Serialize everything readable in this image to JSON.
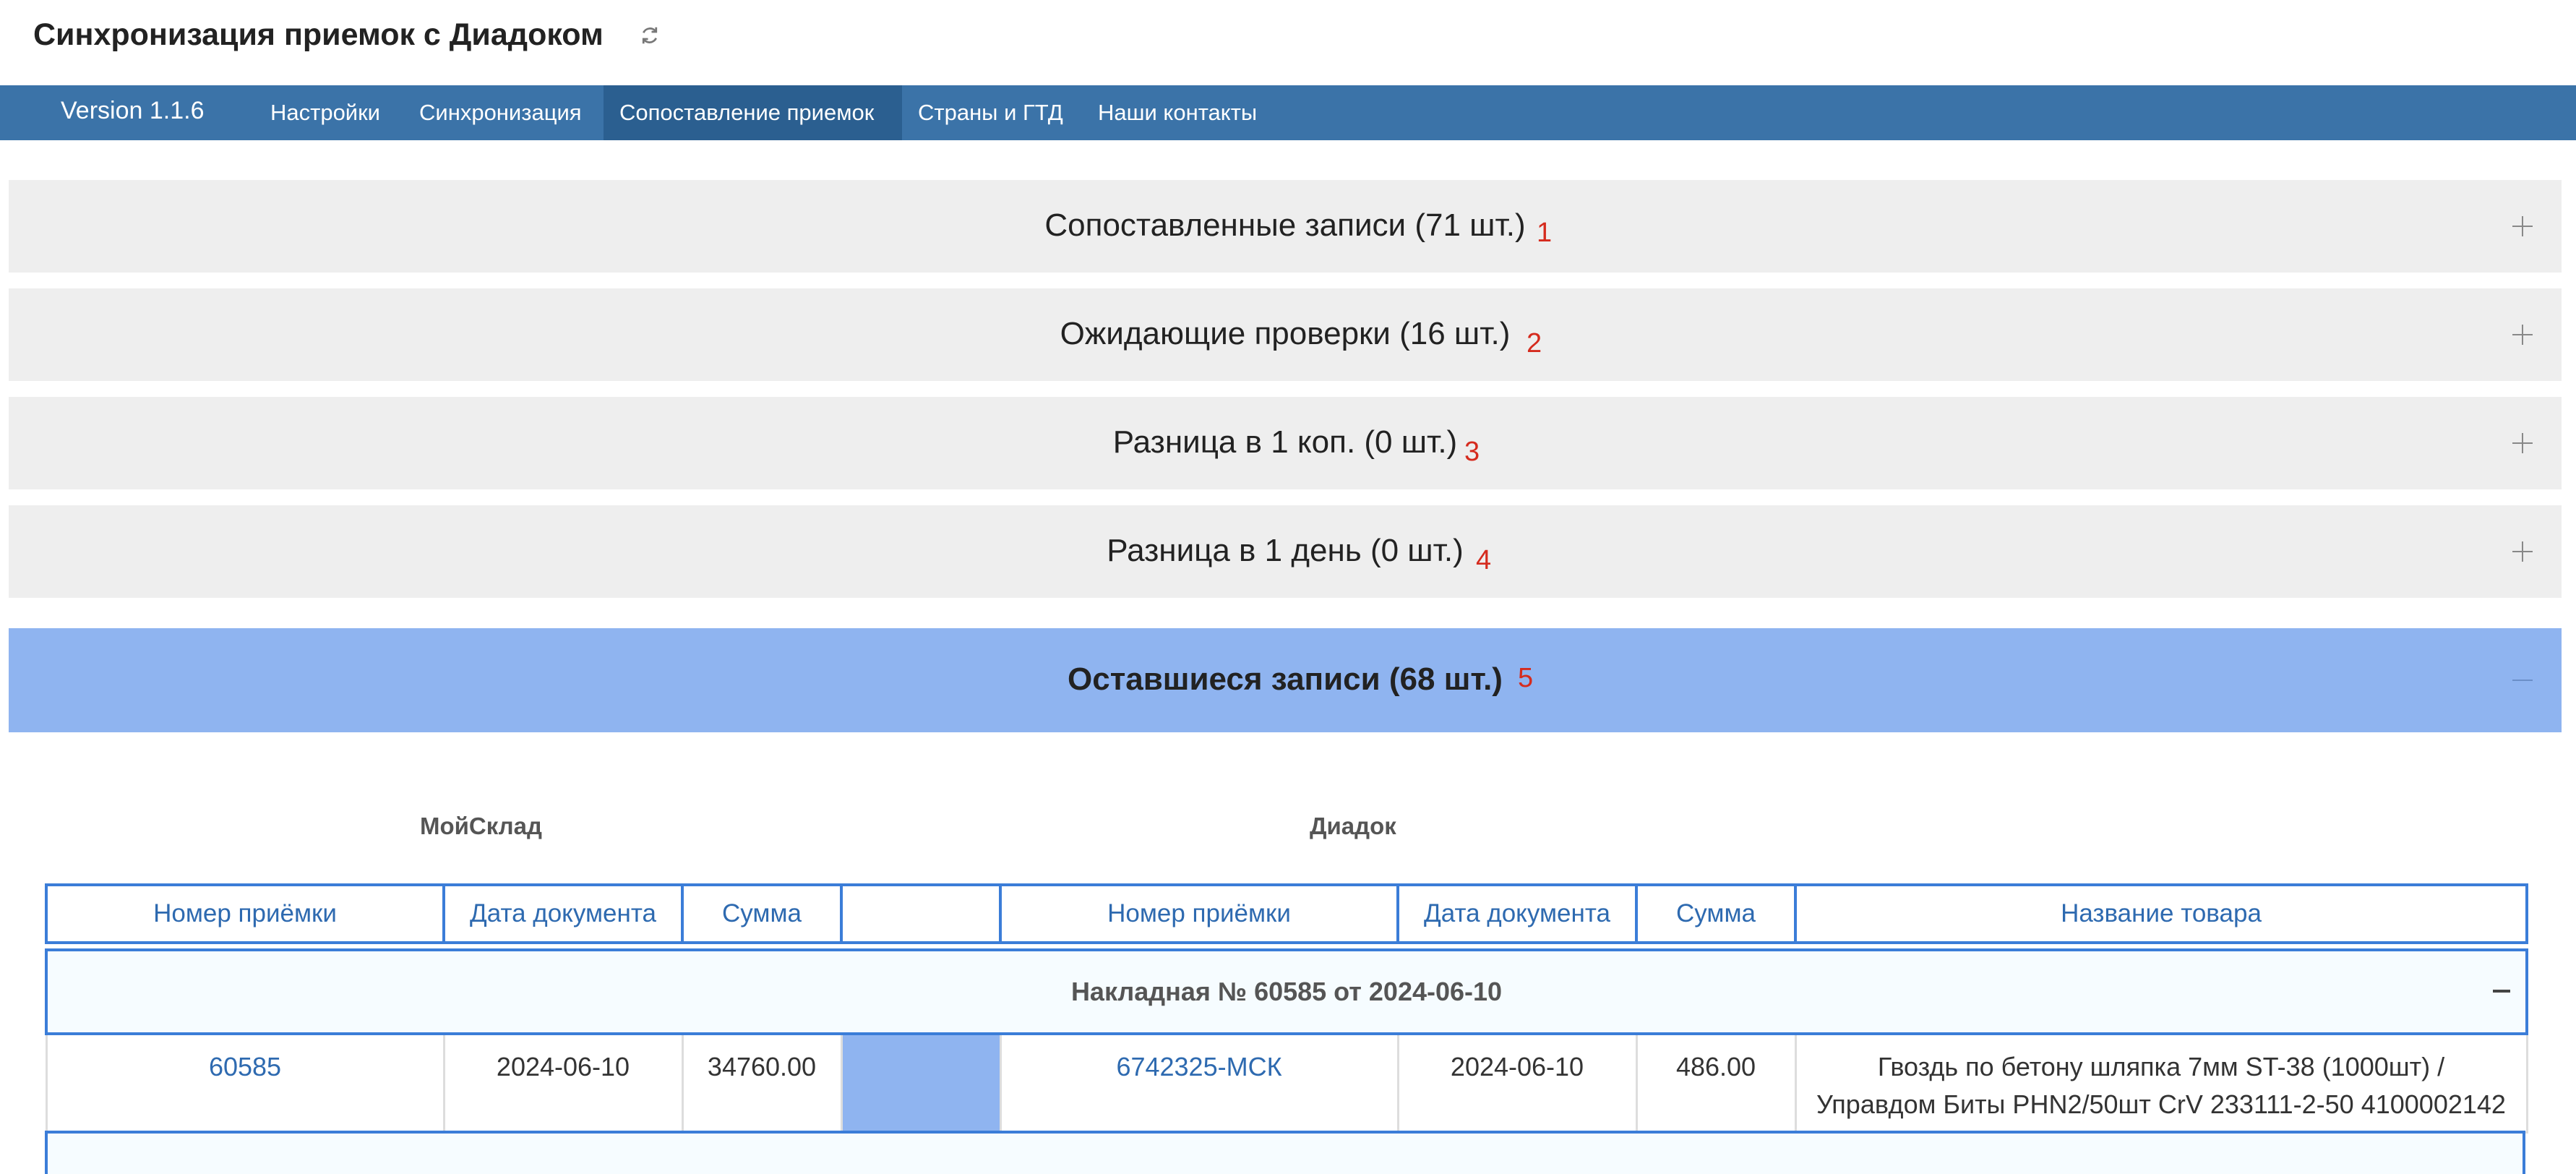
{
  "header": {
    "title": "Синхронизация приемок с Диадоком",
    "refresh_icon": "refresh-icon"
  },
  "nav": {
    "version": "Version 1.1.6",
    "items": [
      {
        "label": "Настройки"
      },
      {
        "label": "Синхронизация"
      },
      {
        "label": "Сопоставление приемок",
        "active": true
      },
      {
        "label": "Страны и ГТД"
      },
      {
        "label": "Наши контакты"
      }
    ],
    "colors": {
      "bar": "#3b73a8",
      "active": "#2b5f90"
    }
  },
  "accordion": [
    {
      "title": "Сопоставленные записи (71 шт.)",
      "num": "1",
      "icon": "plus-icon"
    },
    {
      "title": "Ожидающие проверки (16 шт.)",
      "num": "2",
      "icon": "plus-icon"
    },
    {
      "title": "Разница в 1 коп. (0 шт.)",
      "num": "3",
      "icon": "plus-icon"
    },
    {
      "title": "Разница в 1 день (0 шт.)",
      "num": "4",
      "icon": "plus-icon"
    },
    {
      "title": "Оставшиеся записи (68 шт.)",
      "num": "5",
      "icon": "minus-icon",
      "active": true
    }
  ],
  "annotation_color": "#d52b1e",
  "table": {
    "group_labels": {
      "left": "МойСклад",
      "right": "Диадок"
    },
    "columns": [
      "Номер приёмки",
      "Дата документа",
      "Сумма",
      "",
      "Номер приёмки",
      "Дата документа",
      "Сумма",
      "Название товара"
    ],
    "group_row": {
      "title": "Накладная № 60585 от 2024-06-10",
      "icon": "minus-icon"
    },
    "rows": [
      {
        "ms_number": "60585",
        "ms_date": "2024-06-10",
        "ms_sum": "34760.00",
        "dd_number": "6742325-МСК",
        "dd_date": "2024-06-10",
        "dd_sum": "486.00",
        "product_line1": "Гвоздь по бетону шляпка 7мм ST-38 (1000шт) /",
        "product_line2": "Управдом Биты PHN2/50шт CrV 233111-2-50 4100002142"
      }
    ]
  }
}
